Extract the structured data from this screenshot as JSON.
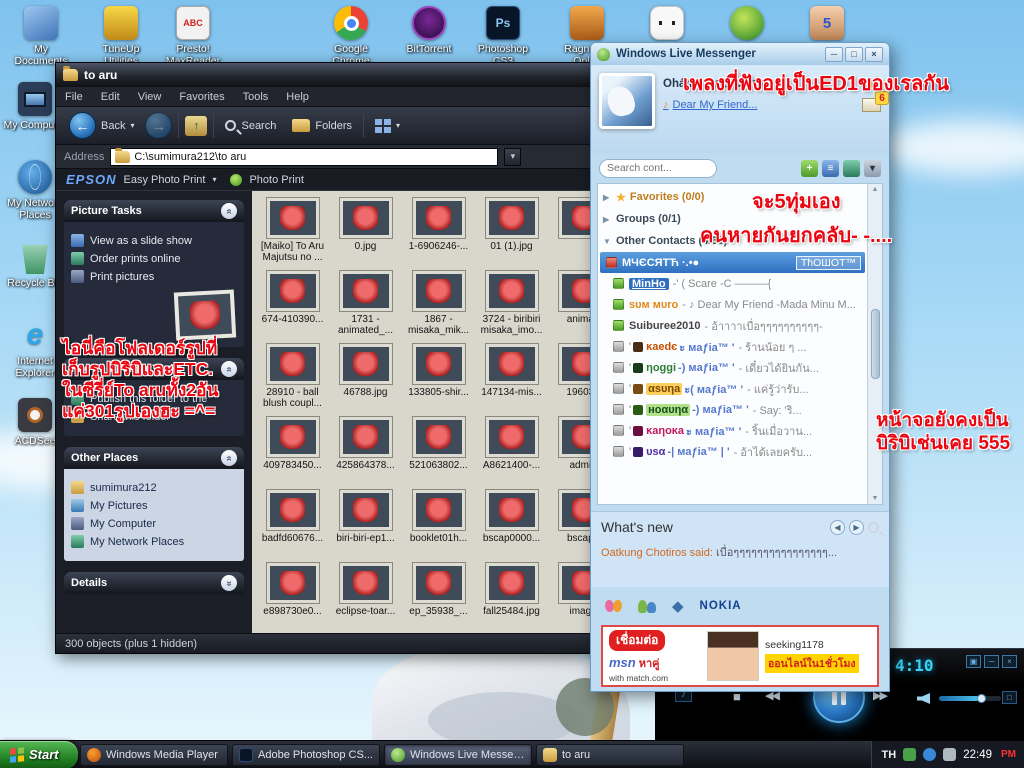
{
  "icons": {
    "back": "←",
    "forward": "→",
    "up": "↑",
    "dropdown": "▾",
    "chevrons": "»",
    "star": "★",
    "arrow_right": "▶",
    "arrow_down": "▼",
    "minimize": "─",
    "maximize": "□",
    "close": "×",
    "note": "♪",
    "stop": "■",
    "prev": "◀◀",
    "next": "▶▶",
    "left": "◀",
    "right": "▶",
    "diamond": "◆",
    "grid": "▣"
  },
  "desktop": {
    "icons_top": [
      {
        "label": "My Documents"
      },
      {
        "label": "TuneUp Utilities"
      },
      {
        "label": "Presto! MaxReader"
      },
      {
        "label": "Google Chrome"
      },
      {
        "label": "BitTorrent"
      },
      {
        "label": "Photoshop CS3"
      },
      {
        "label": "Ragnarok Onli..."
      },
      {
        "label": ""
      },
      {
        "label": ""
      },
      {
        "label": ""
      }
    ],
    "icons_left": [
      {
        "label": "My Computer"
      },
      {
        "label": "My Network Places"
      },
      {
        "label": "Recycle Bin"
      },
      {
        "label": "Internet Explorer"
      },
      {
        "label": "ACDSee"
      }
    ]
  },
  "explorer": {
    "title": "to aru",
    "menus": [
      "File",
      "Edit",
      "View",
      "Favorites",
      "Tools",
      "Help"
    ],
    "toolbar": {
      "back": "Back",
      "search": "Search",
      "folders": "Folders"
    },
    "address_label": "Address",
    "address_value": "C:\\sumimura212\\to aru",
    "epson": {
      "brand": "EPSON",
      "easy": "Easy Photo Print",
      "print": "Photo Print"
    },
    "sidebar": {
      "picture_tasks": {
        "title": "Picture Tasks",
        "items": [
          "View as a slide show",
          "Order prints online",
          "Print pictures"
        ]
      },
      "file_tasks": {
        "title": "File and Folder Tasks",
        "items": [
          "Publish this folder to the",
          "Share this folder"
        ]
      },
      "other_places": {
        "title": "Other Places",
        "items": [
          "sumimura212",
          "My Pictures",
          "My Computer",
          "My Network Places"
        ]
      },
      "details_title": "Details"
    },
    "files": [
      "[Maiko] To Aru Majutsu no ...",
      "0.jpg",
      "1-6906246-...",
      "01 (1).jpg",
      "",
      "674-410390...",
      "1731 - animated_...",
      "1867 - misaka_mik...",
      "3724 - biribiri misaka_imo...",
      "anima...",
      "28910 - ball blush coupl...",
      "46788.jpg",
      "133805-shir...",
      "147134-mis...",
      "19603...",
      "409783450...",
      "425864378...",
      "521063802...",
      "A8621400-...",
      "admi...",
      "badfd60676...",
      "biri-biri-ep1...",
      "booklet01h...",
      "bscap0000...",
      "bscap...",
      "e898730e0...",
      "eclipse-toar...",
      "ep_35938_...",
      "fall25484.jpg",
      "imag..."
    ],
    "status": "300 objects (plus 1 hidden)"
  },
  "messenger": {
    "title": "Windows Live Messenger",
    "header": {
      "status_line": "Ohámo:ขอบกินคาง...",
      "song": "Dear My Friend...",
      "mail_badge": "6"
    },
    "search_placeholder": "Search cont...",
    "groups": [
      {
        "label": "Favorites (0/0)"
      },
      {
        "label": "Groups (0/1)"
      },
      {
        "label": "Other Contacts (4/36)"
      }
    ],
    "contacts": [
      {
        "status": "busy",
        "selected": true,
        "name": "МЧЄСЯТЋ ·.•●",
        "message": "ТћОШОТ™"
      },
      {
        "status": "online",
        "name": "MinHo",
        "message": "-' ( Scare -C ———{"
      },
      {
        "status": "online",
        "name": "sυм мυro",
        "message": "- ♪ Dear My Friend -Mada Minu M..."
      },
      {
        "status": "online",
        "name": "Suiburee2010",
        "message": "- อ้าาาาเบื่อๆๆๆๆๆๆๆๆๆๆ-"
      },
      {
        "status": "offline",
        "pre": "' ",
        "name": "ĸaedє",
        "tag": "ะ мaƒia™ '",
        "message": "- ร้านน้อย ๆ ..."
      },
      {
        "status": "offline",
        "pre": "' ",
        "name": "ηoggi",
        "tag": "-) мaƒia™ '",
        "message": "- เดี๋ยวได้ยินกัน..."
      },
      {
        "status": "offline",
        "pre": "' ",
        "name": "αsυηa",
        "tag": "ะ( мaƒia™ '",
        "message": "- แค่รู้ว่ารับ..."
      },
      {
        "status": "offline",
        "pre": "' ",
        "name": "нoαυηα",
        "tag": "-) мaƒia™ '",
        "message": "- Say: 'ริ..."
      },
      {
        "status": "offline",
        "pre": "' ",
        "name": "ĸaηoĸa",
        "tag": "ะ мaƒia™ '",
        "message": "- ริ้นเมื่อวาน..."
      },
      {
        "status": "offline",
        "pre": "' ",
        "name": "υsα",
        "tag": "-| мaƒia™ | '",
        "message": "- อ้าได้เลยครับ..."
      }
    ],
    "whats_new": {
      "title": "What's new",
      "author": "Oatkung Chotiros said:",
      "text": "เบื่อๆๆๆๆๆๆๆๆๆๆๆๆๆๆๆๆ..."
    },
    "footer_brand": "NOKIA",
    "ad": {
      "connect": "เชื่อมต่อ",
      "msn": "msn",
      "dating": "หาคู่",
      "match": "with match.com",
      "user": "seeking1178",
      "online": "ออนไลน์ใน1ชั่วโมง"
    }
  },
  "media_player": {
    "time": "4:10"
  },
  "annotations": {
    "music": "เพลงที่ฟังอยู่เป็นED1ของเรลกัน",
    "clock": "จะ5ทุ่มเอง",
    "club": "คนหายกันยกคลับ- -....",
    "folder": "ไอนี่คือโฟลเดอร์รูปที่\nเก็บรูปบิริบิและETC.\nในซีรี่ย์To aruทั้ง2อัน\nแค่301รูปเองฮะ =^=",
    "screen": "หน้าจอยังคงเป็น\nบิริบิเช่นเคย 555"
  },
  "taskbar": {
    "start": "Start",
    "tasks": [
      "Windows Media Player",
      "Adobe Photoshop CS...",
      "Windows Live Messen...",
      "to aru"
    ],
    "tray": {
      "lang": "TH",
      "time": "22:49",
      "ampm": "PM"
    }
  }
}
